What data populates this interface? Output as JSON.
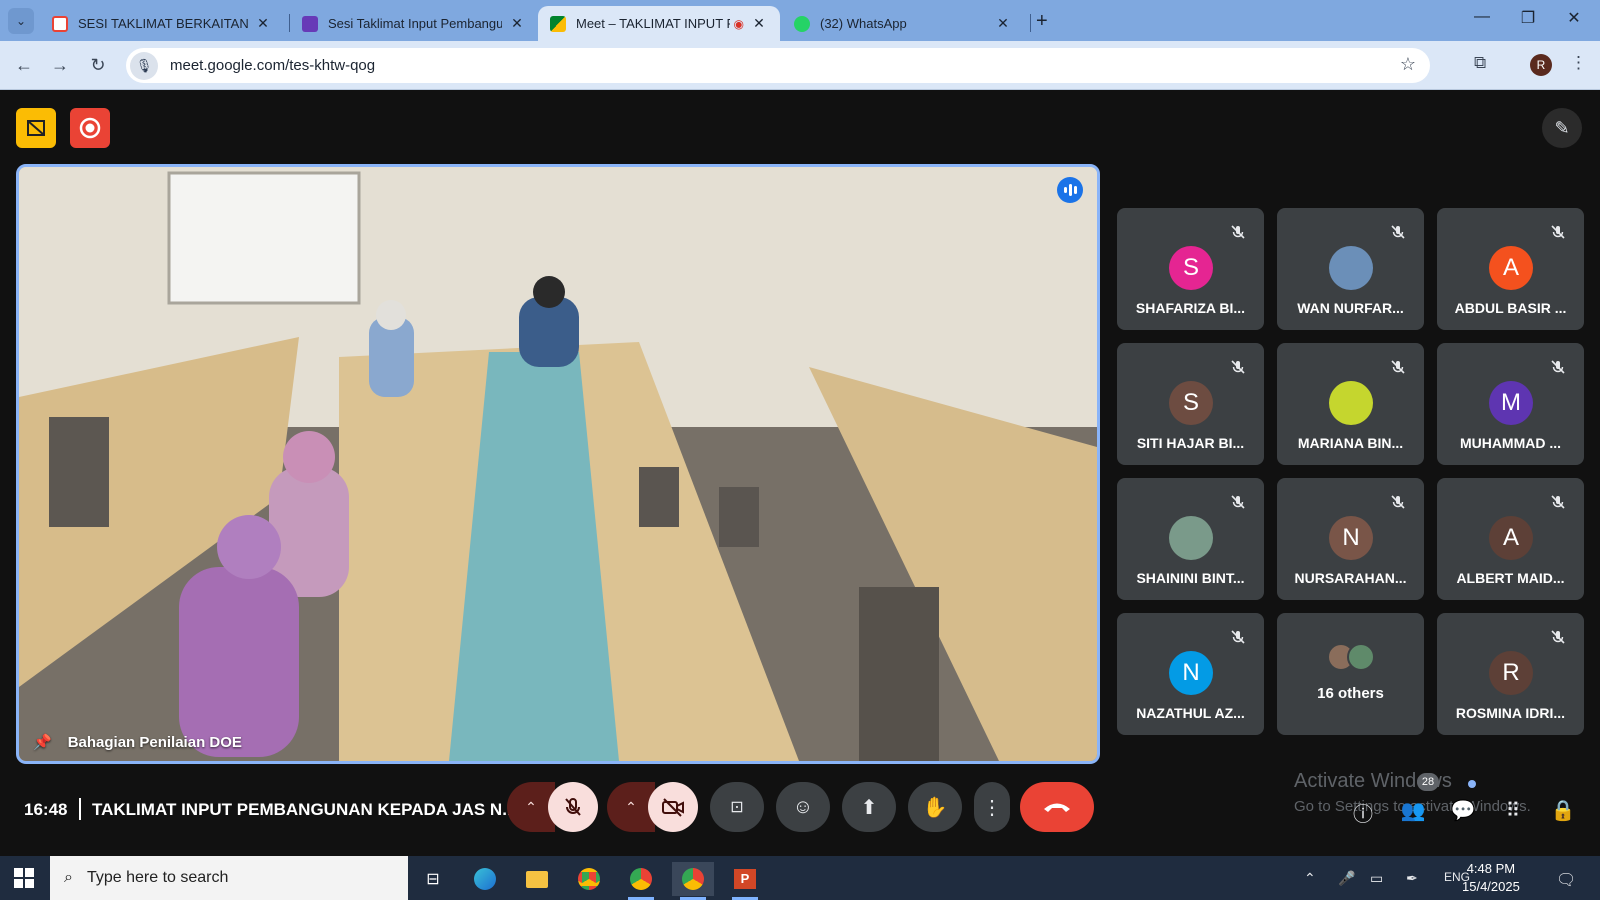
{
  "browser": {
    "tabs": [
      {
        "label": "SESI TAKLIMAT BERKAITAN INP",
        "favicon": "gmail-icon",
        "color": "#ea4335"
      },
      {
        "label": "Sesi Taklimat Input Pembangun",
        "favicon": "forms-icon",
        "color": "#673ab7"
      },
      {
        "label": "Meet – TAKLIMAT INPUT PE",
        "favicon": "meet-icon",
        "color": "#00832d",
        "active": true
      },
      {
        "label": "(32) WhatsApp",
        "favicon": "whatsapp-icon",
        "color": "#25d366"
      }
    ],
    "url": "meet.google.com/tes-khtw-qog",
    "profile_initial": "R"
  },
  "meet": {
    "stage_label": "Bahagian Penilaian DOE",
    "participants": [
      {
        "name": "SHAFARIZA BI...",
        "initial": "S",
        "color": "#e52592",
        "type": "letter"
      },
      {
        "name": "WAN NURFAR...",
        "initial": "",
        "color": "#6b8fb8",
        "type": "photo"
      },
      {
        "name": "ABDUL BASIR ...",
        "initial": "A",
        "color": "#f4511e",
        "type": "letter"
      },
      {
        "name": "SITI HAJAR BI...",
        "initial": "S",
        "color": "#6d4c41",
        "type": "letter"
      },
      {
        "name": "MARIANA BIN...",
        "initial": "",
        "color": "#c5d62e",
        "type": "photo"
      },
      {
        "name": "MUHAMMAD ...",
        "initial": "M",
        "color": "#5e35b1",
        "type": "letter"
      },
      {
        "name": "SHAININI BINT...",
        "initial": "",
        "color": "#7a9a8a",
        "type": "photo"
      },
      {
        "name": "NURSARAHAN...",
        "initial": "N",
        "color": "#795548",
        "type": "letter"
      },
      {
        "name": "ALBERT MAID...",
        "initial": "A",
        "color": "#5d4037",
        "type": "letter"
      },
      {
        "name": "NAZATHUL AZ...",
        "initial": "N",
        "color": "#039be5",
        "type": "letter"
      },
      {
        "name": "16 others",
        "initial": "",
        "color": "#3c4043",
        "type": "others"
      },
      {
        "name": "ROSMINA IDRI...",
        "initial": "R",
        "color": "#5d4037",
        "type": "letter"
      }
    ],
    "clock": "16:48",
    "meeting_title": "TAKLIMAT INPUT PEMBANGUNAN KEPADA JAS N...",
    "participant_count": "28",
    "watermark_title": "Activate Windows",
    "watermark_sub": "Go to Settings to activate Windows."
  },
  "taskbar": {
    "search_placeholder": "Type here to search",
    "language": "ENG",
    "time": "4:48 PM",
    "date": "15/4/2025"
  }
}
